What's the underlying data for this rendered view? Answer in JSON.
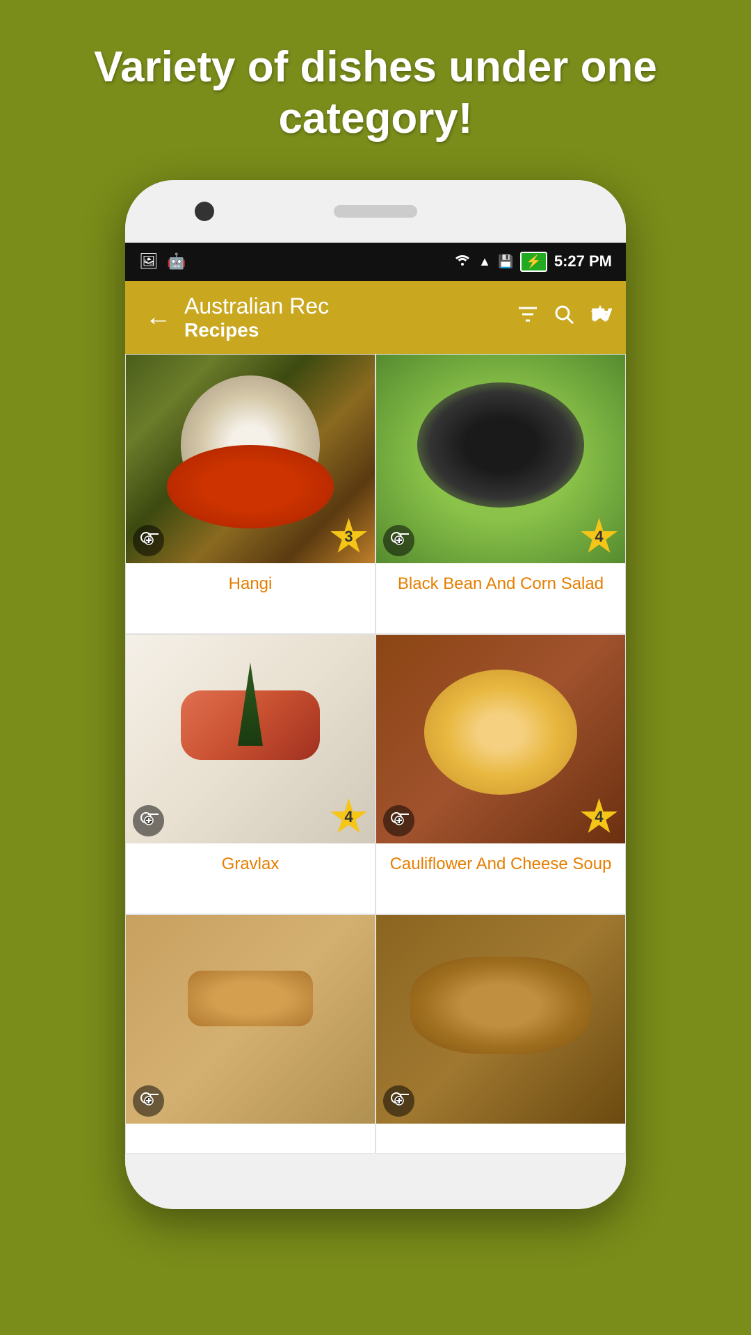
{
  "hero": {
    "text": "Variety of dishes under one category!"
  },
  "status_bar": {
    "time": "5:27 PM",
    "wifi_icon": "wifi",
    "signal_icon": "signal",
    "battery_icon": "battery",
    "left_icons": [
      "image-icon",
      "android-icon"
    ]
  },
  "app_bar": {
    "title": "Australian Rec",
    "subtitle": "Recipes",
    "back_label": "←",
    "filter_icon": "filter",
    "search_icon": "search",
    "fav_icon": "favorite"
  },
  "recipes": [
    {
      "id": 1,
      "name": "Hangi",
      "rating": 3,
      "food_class": "food-hangi"
    },
    {
      "id": 2,
      "name": "Black Bean And Corn Salad",
      "rating": 4,
      "food_class": "food-blackbean"
    },
    {
      "id": 3,
      "name": "Gravlax",
      "rating": 4,
      "food_class": "food-gravlax"
    },
    {
      "id": 4,
      "name": "Cauliflower And Cheese Soup",
      "rating": 4,
      "food_class": "food-soup"
    },
    {
      "id": 5,
      "name": "",
      "rating": null,
      "food_class": "food-cookies"
    },
    {
      "id": 6,
      "name": "",
      "rating": null,
      "food_class": "food-bread"
    }
  ],
  "colors": {
    "background": "#7a8c1a",
    "app_bar": "#c9a820",
    "recipe_name": "#e67e00",
    "rating_badge": "#f5c518"
  }
}
